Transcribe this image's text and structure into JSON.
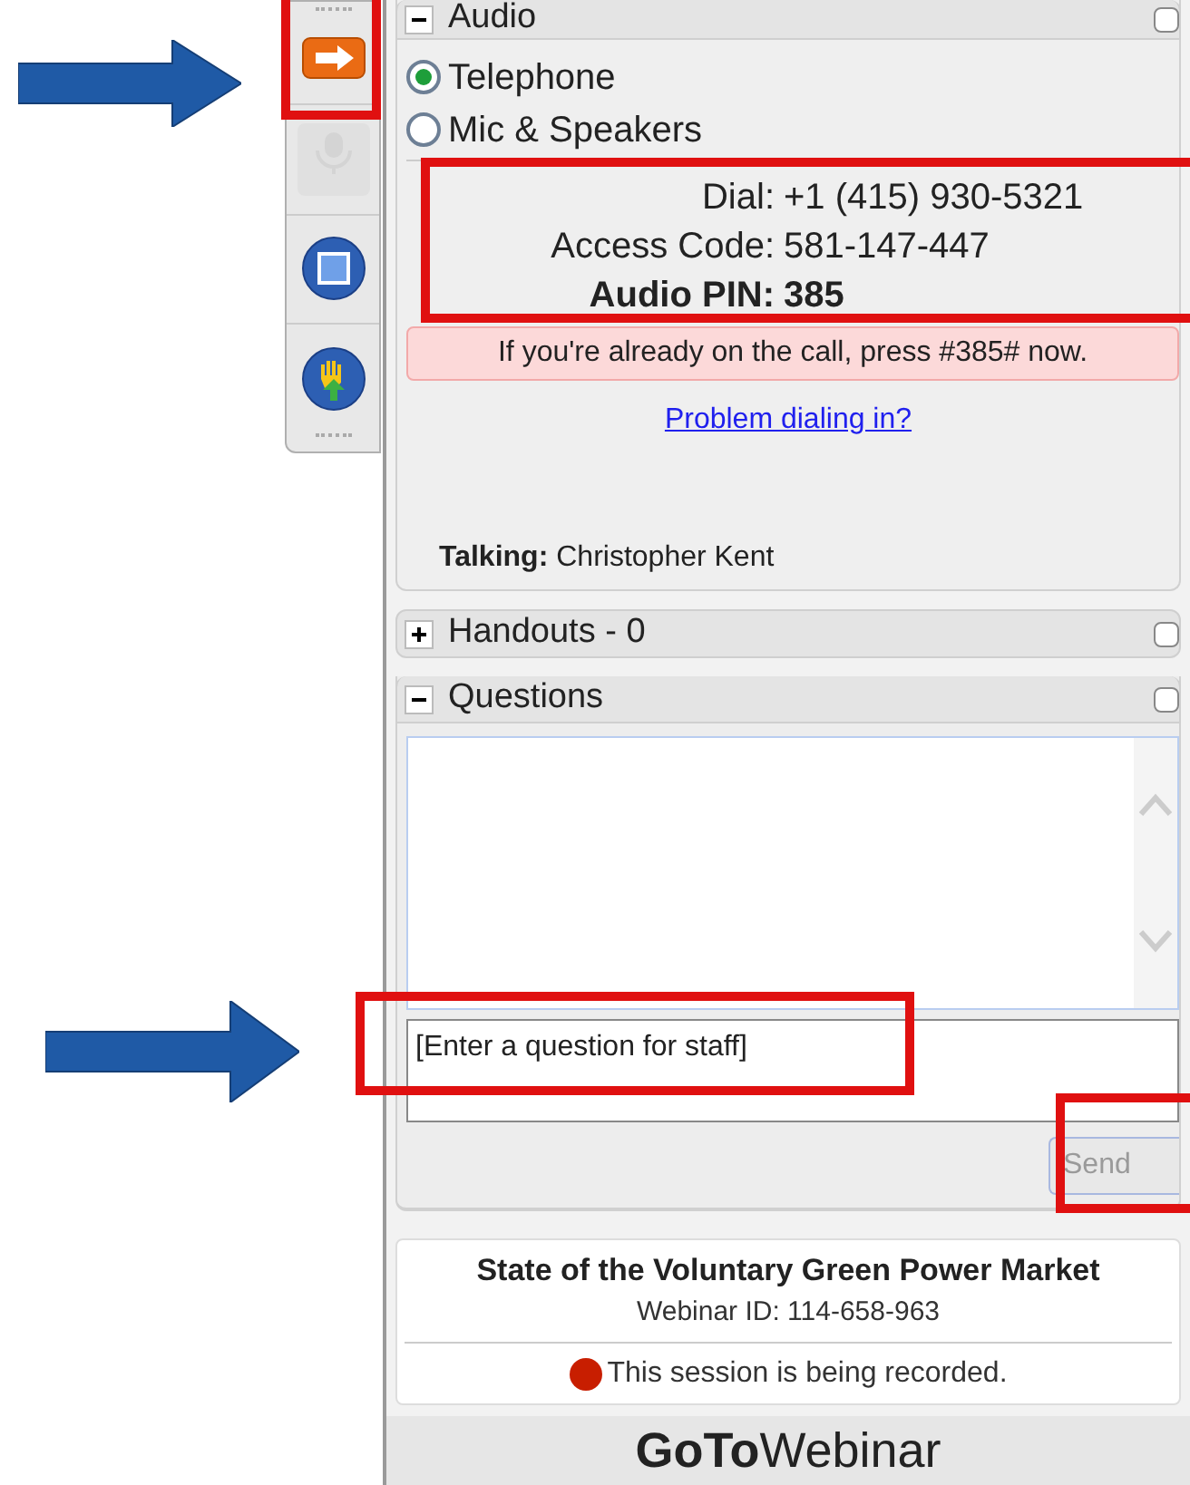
{
  "toolbar": [
    {
      "kind": "arrow",
      "disabled": false
    },
    {
      "kind": "mic",
      "disabled": true
    },
    {
      "kind": "screen",
      "disabled": false
    },
    {
      "kind": "hand",
      "disabled": false
    }
  ],
  "audio": {
    "title": "Audio",
    "expanded": true,
    "options": [
      {
        "label": "Telephone",
        "selected": true
      },
      {
        "label": "Mic & Speakers",
        "selected": false
      }
    ],
    "dial_info": [
      {
        "label": "Dial:",
        "value": "+1 (415) 930-5321",
        "bold": false
      },
      {
        "label": "Access Code:",
        "value": "581-147-447",
        "bold": false
      },
      {
        "label": "Audio PIN:",
        "value": "385",
        "bold": true
      }
    ],
    "notice": "If you're already on the call, press #385# now.",
    "link": "Problem dialing in?",
    "talking": {
      "label": "Talking:",
      "name": "Christopher Kent"
    }
  },
  "handouts": {
    "title": "Handouts - 0",
    "expanded": false
  },
  "questions": {
    "title": "Questions",
    "expanded": true,
    "input": {
      "placeholder": "[Enter a question for staff]"
    },
    "send_button": "Send"
  },
  "session": {
    "title": "State of the Voluntary Green Power Market",
    "webinar_id": "Webinar ID: 114-658-963",
    "recording": "This session is being recorded."
  },
  "brand": {
    "bold": "GoTo",
    "light": "Webinar"
  }
}
